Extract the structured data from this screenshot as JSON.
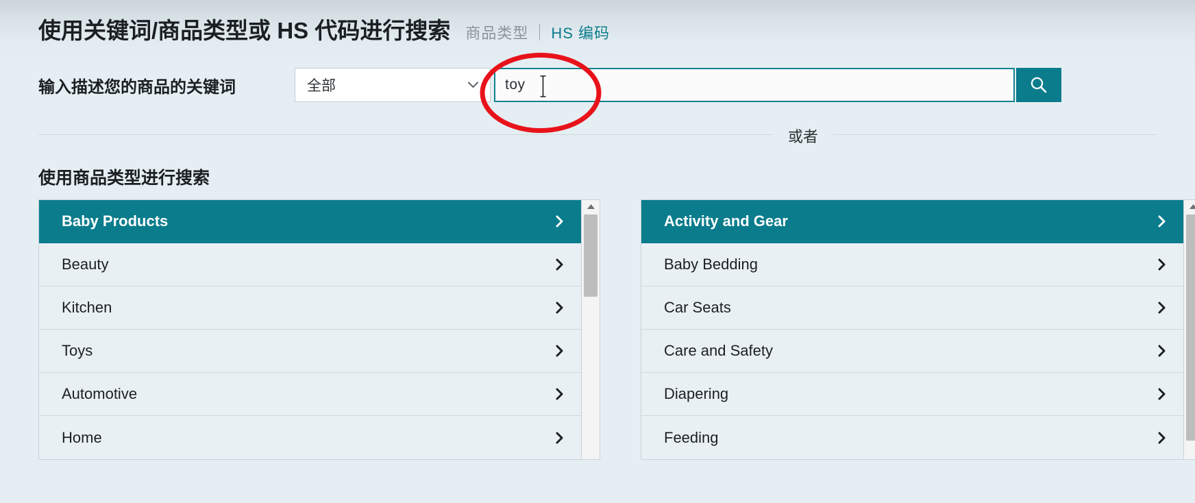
{
  "header": {
    "title": "使用关键词/商品类型或 HS 代码进行搜索",
    "link_product_type": "商品类型",
    "link_hs_code": "HS 编码"
  },
  "search": {
    "label": "输入描述您的商品的关键词",
    "category_select_value": "全部",
    "keyword_value": "toy",
    "keyword_placeholder": "",
    "submit_icon": "search-icon",
    "dropdown_icon": "chevron-down-icon",
    "cursor_icon": "text-ibeam-cursor"
  },
  "divider": {
    "or_text": "或者"
  },
  "browse": {
    "heading": "使用商品类型进行搜索",
    "left_panel": {
      "items": [
        {
          "label": "Baby Products",
          "selected": true
        },
        {
          "label": "Beauty",
          "selected": false
        },
        {
          "label": "Kitchen",
          "selected": false
        },
        {
          "label": "Toys",
          "selected": false
        },
        {
          "label": "Automotive",
          "selected": false
        },
        {
          "label": "Home",
          "selected": false
        }
      ],
      "scrollbar": {
        "up_icon": "caret-up-icon",
        "thumb": "short"
      }
    },
    "right_panel": {
      "items": [
        {
          "label": "Activity and Gear",
          "selected": true
        },
        {
          "label": "Baby Bedding",
          "selected": false
        },
        {
          "label": "Car Seats",
          "selected": false
        },
        {
          "label": "Care and Safety",
          "selected": false
        },
        {
          "label": "Diapering",
          "selected": false
        },
        {
          "label": "Feeding",
          "selected": false
        }
      ],
      "scrollbar": {
        "up_icon": "caret-up-icon",
        "thumb": "tall"
      }
    },
    "row_icon": "chevron-right-icon"
  },
  "annotation": {
    "shape": "red-ellipse-highlight",
    "color": "#e8131a"
  },
  "colors": {
    "accent_teal": "#0a7c8c",
    "page_background": "#e5eef3",
    "row_background": "#e9f0f4",
    "annotation_red": "#e8131a",
    "muted_text": "#8d9499"
  }
}
